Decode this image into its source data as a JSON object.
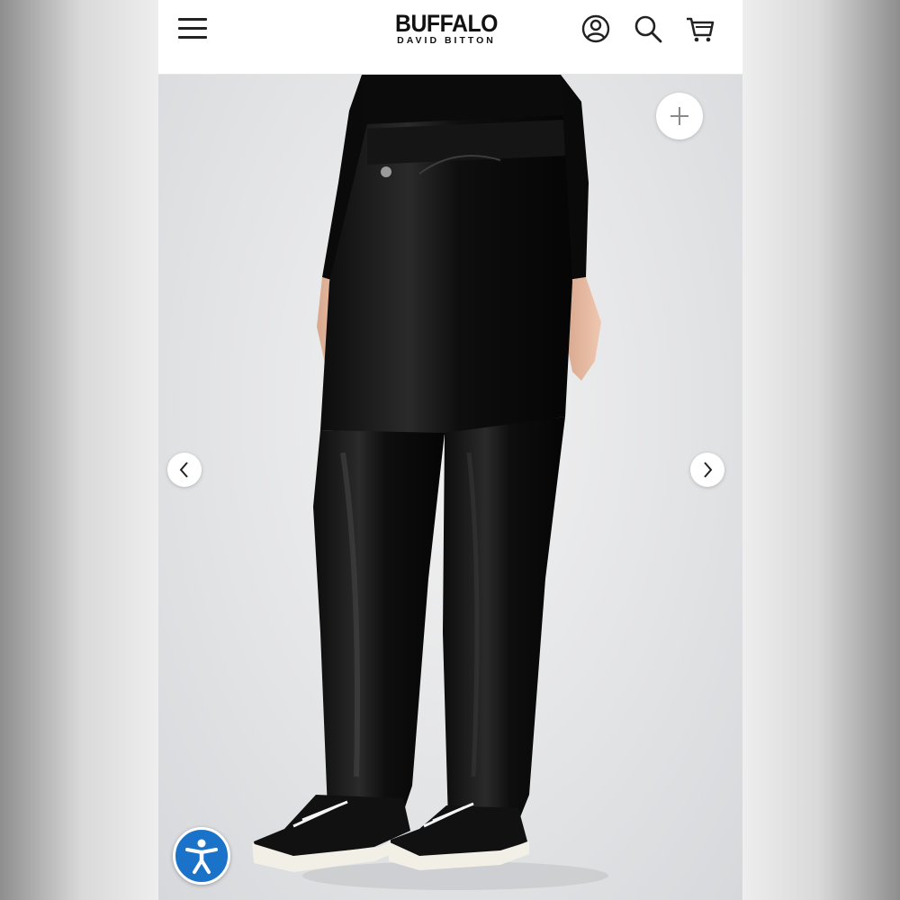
{
  "header": {
    "brand": "BUFFALO",
    "sub_brand": "DAVID BITTON",
    "menu_icon": "hamburger-menu-icon",
    "account_icon": "account-icon",
    "search_icon": "search-icon",
    "cart_icon": "cart-icon"
  },
  "gallery": {
    "zoom_icon": "plus-icon",
    "prev_icon": "chevron-left-icon",
    "next_icon": "chevron-right-icon"
  },
  "accessibility": {
    "icon": "accessibility-icon",
    "color": "#1a73c8"
  }
}
